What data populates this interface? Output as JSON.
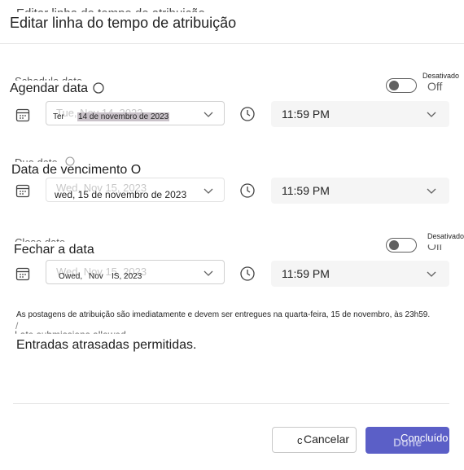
{
  "dialog": {
    "title": "Editar linha do tempo de atribuição",
    "title_ghost": "Editar linha do tempo de atribuição"
  },
  "schedule": {
    "ghost_label": "Schedule date",
    "label": "Agendar data",
    "toggle_state_label": "Desativado",
    "toggle_text": "Off",
    "date_ghost": "Tue, Nov 14, 2023",
    "date_prefix": "Ter",
    "date_value": "14 de novembro de 2023",
    "time_value": "11:59 PM"
  },
  "due": {
    "ghost_label": "Due date",
    "label": "Data de vencimento",
    "date_ghost": "Wed, Nov 15, 2023",
    "date_value": "wed, 15 de novembro de 2023",
    "time_value": "11:59 PM"
  },
  "close": {
    "ghost_label": "Close date",
    "label": "Fechar a data",
    "toggle_state_label": "Desativado",
    "toggle_text": "Off",
    "date_ghost": "Wed, Nov 15, 2023",
    "date_p1": "O",
    "date_p2": "wed,",
    "date_p3": "Nov",
    "date_p4": "IS, 2023",
    "time_value": "11:59 PM"
  },
  "info": {
    "note": "As postagens de atribuição são imediatamente e devem ser entregues na quarta-feira, 15 de novembro, às 23h59.",
    "late_ghost": "Late submissions allowed.",
    "late_label": "Entradas atrasadas permitidas."
  },
  "footer": {
    "cancel_label": "Cancelar",
    "done_ghost": "Done",
    "done_label": "Concluído"
  },
  "colors": {
    "accent": "#5b5fc7",
    "divider": "#e6e6e6"
  },
  "icons": [
    "calendar-icon",
    "clock-icon",
    "chevron-down-icon",
    "info-icon"
  ]
}
